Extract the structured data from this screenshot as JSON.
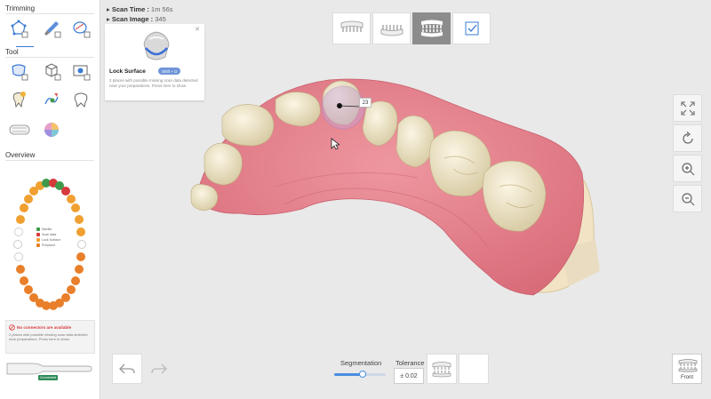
{
  "sidebar": {
    "trimming_title": "Trimming",
    "tool_title": "Tool",
    "overview_title": "Overview",
    "trimming_tools": [
      {
        "icon": "polygon-trim-icon"
      },
      {
        "icon": "brush-trim-icon"
      },
      {
        "icon": "lasso-trim-icon"
      }
    ],
    "tools": [
      {
        "icon": "lock-surface-icon"
      },
      {
        "icon": "box-tool-icon"
      },
      {
        "icon": "camera-capture-icon"
      },
      {
        "icon": "tooth-fill-icon"
      },
      {
        "icon": "marker-tool-icon"
      },
      {
        "icon": "tooth-outline-icon"
      },
      {
        "icon": "occlusion-icon",
        "label": "Occlusion"
      },
      {
        "icon": "color-wheel-icon"
      }
    ],
    "legend": [
      "Maxilla",
      "Scan data",
      "Lock Surface",
      "Prepared"
    ],
    "warning": {
      "title": "No connectors are available",
      "description": "2 places with possible missing scan data detected near preparations. Press here to show."
    },
    "device_status": "Connected"
  },
  "scan_info": {
    "time_label": "Scan Time :",
    "time_value": "1m 56s",
    "image_label": "Scan Image :",
    "image_value": "345"
  },
  "lock_card": {
    "title": "Lock Surface",
    "badge": "Shift + D",
    "description": "2 places with possible missing scan data detected near your preparations. Press here to show"
  },
  "view_toggles": [
    {
      "name": "upper-jaw",
      "active": false
    },
    {
      "name": "lower-jaw",
      "active": false
    },
    {
      "name": "both-jaws",
      "active": true
    },
    {
      "name": "confirm",
      "active": false
    }
  ],
  "selected_tooth": "23",
  "bottom": {
    "segmentation_label": "Segmentation",
    "segmentation_value": 0.55,
    "tolerance_label": "Tolerance",
    "tolerance_value": "± 0.02",
    "front_label": "Front"
  },
  "colors": {
    "gum": "#e8858e",
    "tooth": "#efe6c8",
    "accent": "#4a8de0",
    "warning": "#d9383a",
    "tooth_orange": "#f0a030",
    "tooth_red": "#d63a3a",
    "tooth_green": "#3e9a4a",
    "tooth_deep_orange": "#e97f2a"
  }
}
